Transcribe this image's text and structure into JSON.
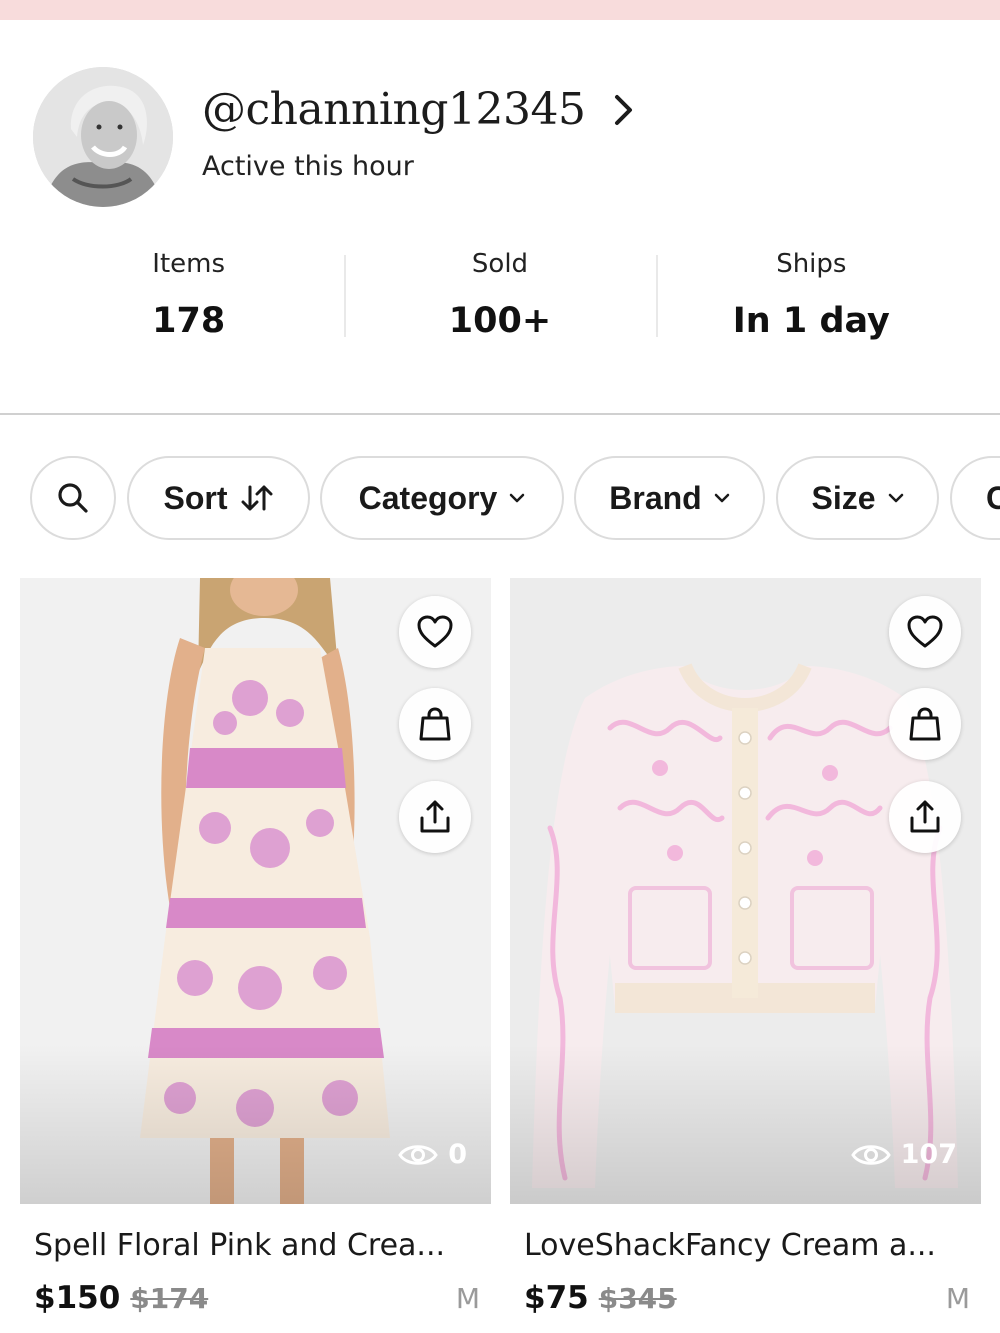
{
  "profile": {
    "username": "@channing12345",
    "status": "Active this hour",
    "stats": [
      {
        "label": "Items",
        "value": "178"
      },
      {
        "label": "Sold",
        "value": "100+"
      },
      {
        "label": "Ships",
        "value": "In 1 day"
      }
    ]
  },
  "filters": {
    "search_icon": "search-icon",
    "sort": "Sort",
    "category": "Category",
    "brand": "Brand",
    "size": "Size",
    "more": "C"
  },
  "products": [
    {
      "title": "Spell Floral Pink and Crea...",
      "price": "$150",
      "original_price": "$174",
      "size": "M",
      "views": "0",
      "icons": [
        "heart-icon",
        "shopping-bag-icon",
        "share-icon",
        "eye-icon"
      ]
    },
    {
      "title": "LoveShackFancy Cream a...",
      "price": "$75",
      "original_price": "$345",
      "size": "M",
      "views": "107",
      "icons": [
        "heart-icon",
        "shopping-bag-icon",
        "share-icon",
        "eye-icon"
      ]
    }
  ],
  "colors": {
    "top_strip": "#f8dcdc",
    "dress_pink": "#d889c8",
    "cardigan_pink": "#f2b8dc",
    "cream": "#f7ecdf"
  }
}
